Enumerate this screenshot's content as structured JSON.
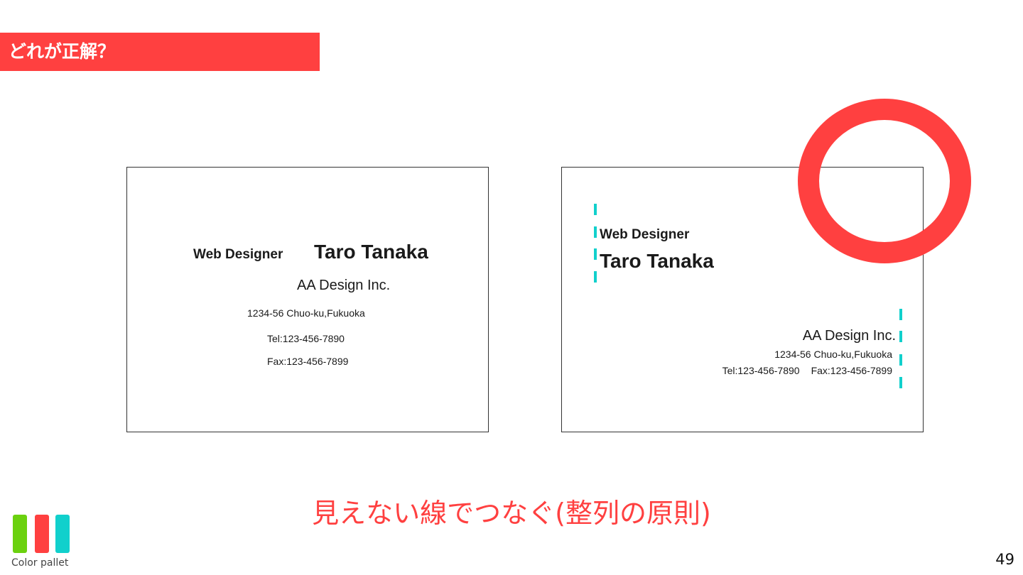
{
  "header": {
    "title": "どれが正解？"
  },
  "card_left": {
    "role": "Web Designer",
    "name": "Taro Tanaka",
    "company": "AA Design Inc.",
    "address": "1234-56 Chuo-ku,Fukuoka",
    "tel": "Tel:123-456-7890",
    "fax": "Fax:123-456-7899"
  },
  "card_right": {
    "role": "Web Designer",
    "name": "Taro Tanaka",
    "company": "AA Design Inc.",
    "address": "1234-56 Chuo-ku,Fukuoka",
    "tel": "Tel:123-456-7890",
    "fax": "Fax:123-456-7899"
  },
  "caption": "見えない線でつなぐ(整列の原則)",
  "footer": {
    "palette_label": "Color pallet",
    "page_number": "49"
  },
  "colors": {
    "accent_red": "#ff4040",
    "guide_cyan": "#11d0cc",
    "palette": [
      "#6bd10f",
      "#ff4040",
      "#11d0cc"
    ]
  },
  "icons": {
    "highlight": "correct-answer-ring-icon",
    "guides": "alignment-guide-dashes"
  }
}
